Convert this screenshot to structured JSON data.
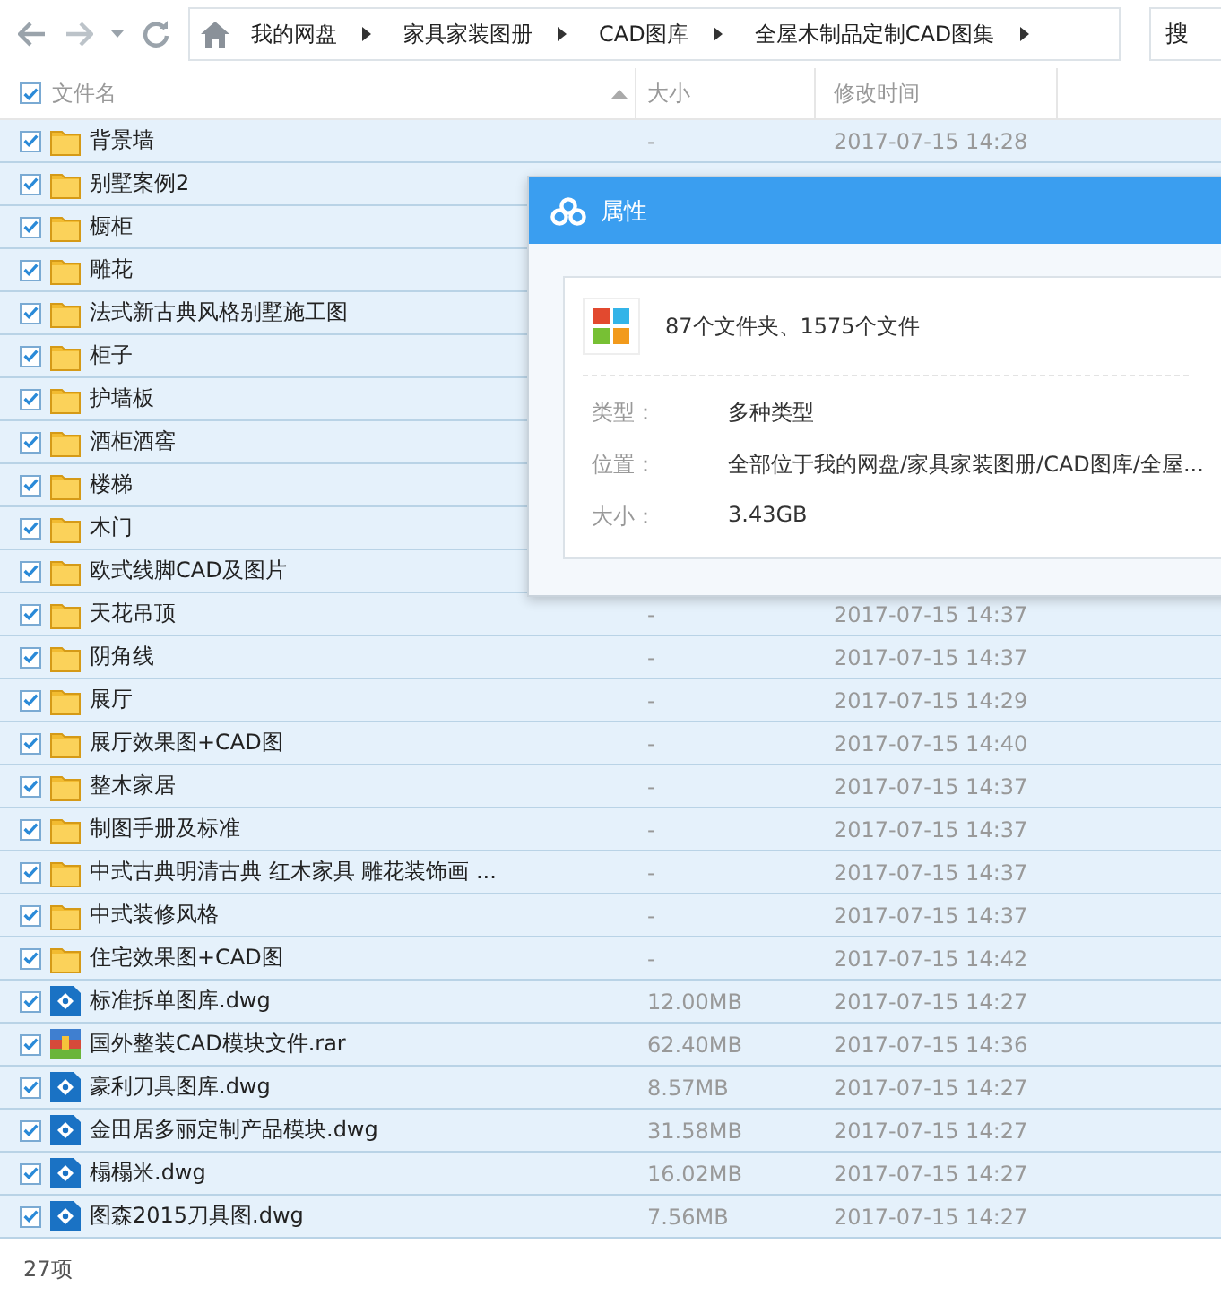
{
  "toolbar": {
    "breadcrumb": [
      "我的网盘",
      "家具家装图册",
      "CAD图库",
      "全屋木制品定制CAD图集"
    ],
    "search": {
      "placeholder": "搜"
    }
  },
  "table": {
    "header_checked": true,
    "columns": [
      "文件名",
      "大小",
      "修改时间"
    ],
    "rows": [
      {
        "kind": "folder",
        "checked": true,
        "name": "背景墙",
        "size": "-",
        "modified": "2017-07-15 14:28"
      },
      {
        "kind": "folder",
        "checked": true,
        "name": "别墅案例2"
      },
      {
        "kind": "folder",
        "checked": true,
        "name": "橱柜"
      },
      {
        "kind": "folder",
        "checked": true,
        "name": "雕花"
      },
      {
        "kind": "folder",
        "checked": true,
        "name": "法式新古典风格别墅施工图"
      },
      {
        "kind": "folder",
        "checked": true,
        "name": "柜子"
      },
      {
        "kind": "folder",
        "checked": true,
        "name": "护墙板"
      },
      {
        "kind": "folder",
        "checked": true,
        "name": "酒柜酒窖"
      },
      {
        "kind": "folder",
        "checked": true,
        "name": "楼梯"
      },
      {
        "kind": "folder",
        "checked": true,
        "name": "木门"
      },
      {
        "kind": "folder",
        "checked": true,
        "name": "欧式线脚CAD及图片"
      },
      {
        "kind": "folder",
        "checked": true,
        "name": "天花吊顶",
        "size": "-",
        "modified": "2017-07-15 14:37"
      },
      {
        "kind": "folder",
        "checked": true,
        "name": "阴角线",
        "size": "-",
        "modified": "2017-07-15 14:37"
      },
      {
        "kind": "folder",
        "checked": true,
        "name": "展厅",
        "size": "-",
        "modified": "2017-07-15 14:29"
      },
      {
        "kind": "folder",
        "checked": true,
        "name": "展厅效果图+CAD图",
        "size": "-",
        "modified": "2017-07-15 14:40"
      },
      {
        "kind": "folder",
        "checked": true,
        "name": "整木家居",
        "size": "-",
        "modified": "2017-07-15 14:37"
      },
      {
        "kind": "folder",
        "checked": true,
        "name": "制图手册及标准",
        "size": "-",
        "modified": "2017-07-15 14:37"
      },
      {
        "kind": "folder",
        "checked": true,
        "name": "中式古典明清古典 红木家具 雕花装饰画 ...",
        "size": "-",
        "modified": "2017-07-15 14:37"
      },
      {
        "kind": "folder",
        "checked": true,
        "name": "中式装修风格",
        "size": "-",
        "modified": "2017-07-15 14:37"
      },
      {
        "kind": "folder",
        "checked": true,
        "name": "住宅效果图+CAD图",
        "size": "-",
        "modified": "2017-07-15 14:42"
      },
      {
        "kind": "dwg",
        "checked": true,
        "name": "标准拆单图库.dwg",
        "size": "12.00MB",
        "modified": "2017-07-15 14:27"
      },
      {
        "kind": "rar",
        "checked": true,
        "name": "国外整装CAD模块文件.rar",
        "size": "62.40MB",
        "modified": "2017-07-15 14:36"
      },
      {
        "kind": "dwg",
        "checked": true,
        "name": "豪利刀具图库.dwg",
        "size": "8.57MB",
        "modified": "2017-07-15 14:27"
      },
      {
        "kind": "dwg",
        "checked": true,
        "name": "金田居多丽定制产品模块.dwg",
        "size": "31.58MB",
        "modified": "2017-07-15 14:27"
      },
      {
        "kind": "dwg",
        "checked": true,
        "name": "榻榻米.dwg",
        "size": "16.02MB",
        "modified": "2017-07-15 14:27"
      },
      {
        "kind": "dwg",
        "checked": true,
        "name": "图森2015刀具图.dwg",
        "size": "7.56MB",
        "modified": "2017-07-15 14:27"
      }
    ]
  },
  "status_bar": {
    "count": "27项"
  },
  "dialog": {
    "title": "属性",
    "summary": "87个文件夹、1575个文件",
    "fields": [
      {
        "label": "类型：",
        "value": "多种类型"
      },
      {
        "label": "位置：",
        "value": "全部位于我的网盘/家具家装图册/CAD图库/全屋..."
      },
      {
        "label": "大小：",
        "value": "3.43GB"
      }
    ]
  }
}
